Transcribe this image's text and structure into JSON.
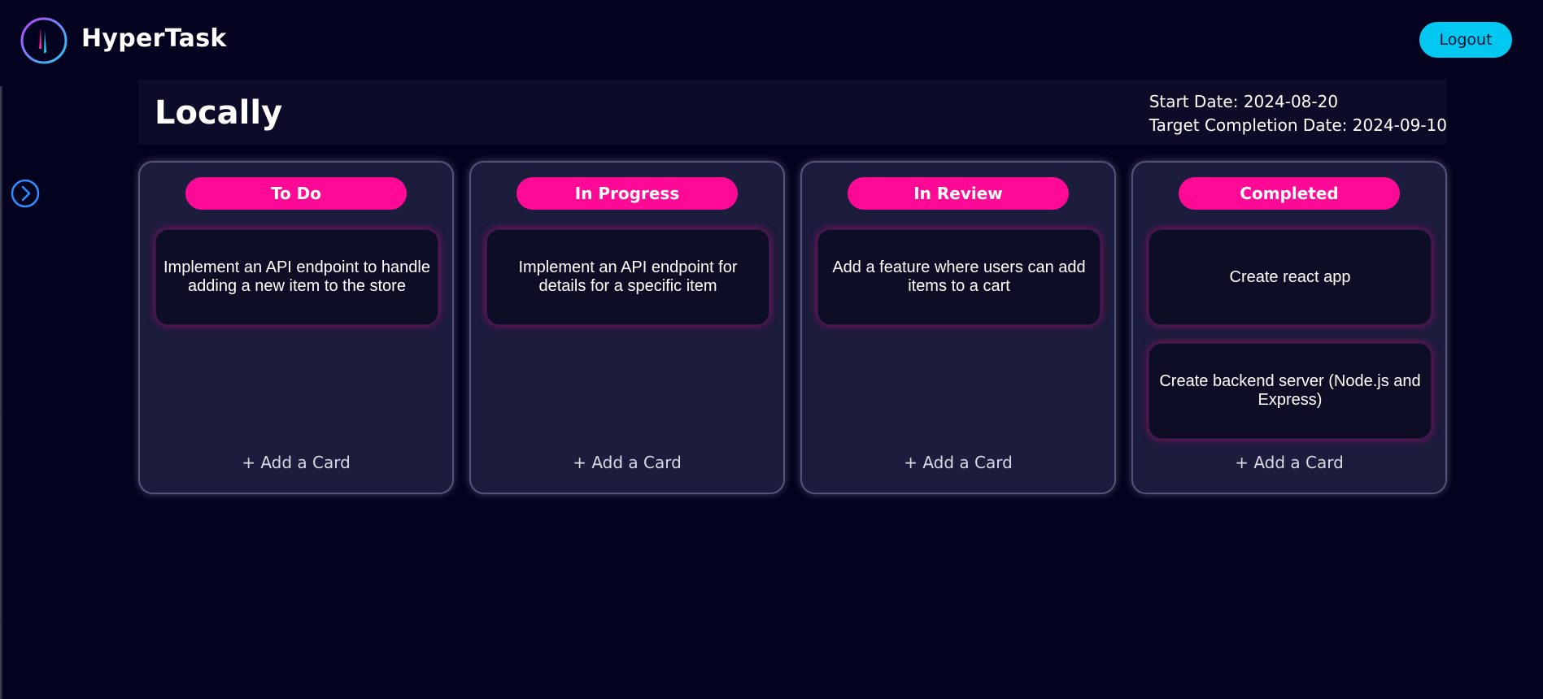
{
  "app": {
    "name": "HyperTask"
  },
  "header": {
    "logout_label": "Logout"
  },
  "project": {
    "title": "Locally",
    "start_date": "Start Date: 2024-08-20",
    "target_date": "Target Completion Date: 2024-09-10"
  },
  "colors": {
    "background": "#03031f",
    "accent_pink": "#ff0a96",
    "accent_cyan": "#00c8f0",
    "column_bg": "#1c1c3c",
    "card_bg": "#0d0d26"
  },
  "icons": {
    "logo": "hypertask-logo-icon",
    "sidebar_toggle": "chevron-right-circle-icon"
  },
  "columns": [
    {
      "title": "To Do",
      "cards": [
        "Implement an API endpoint to handle adding a new item to the store"
      ],
      "add_label": "+ Add a Card"
    },
    {
      "title": "In Progress",
      "cards": [
        "Implement an API endpoint for details for a specific item"
      ],
      "add_label": "+ Add a Card"
    },
    {
      "title": "In Review",
      "cards": [
        "Add a feature where users can add items to a cart"
      ],
      "add_label": "+ Add a Card"
    },
    {
      "title": "Completed",
      "cards": [
        "Create react app",
        "Create backend server (Node.js and Express)"
      ],
      "add_label": "+ Add a Card"
    }
  ]
}
